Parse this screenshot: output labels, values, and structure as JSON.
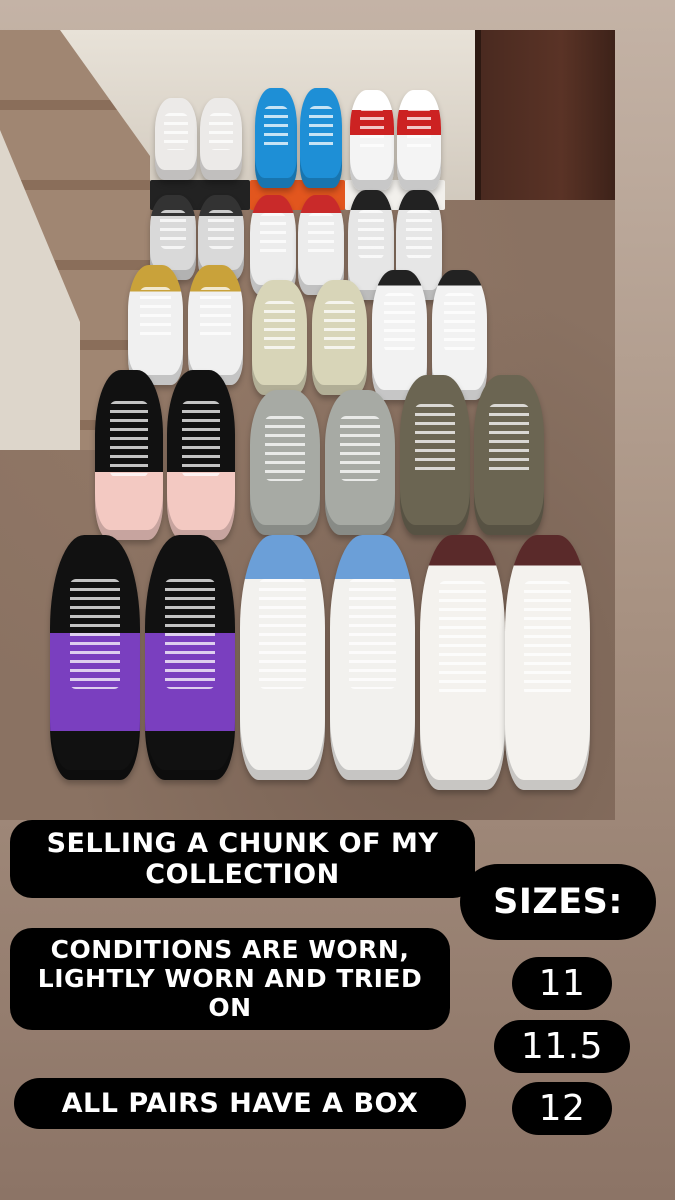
{
  "story": {
    "headline_line1": "SELLING A CHUNK OF MY",
    "headline_line2": "COLLECTION",
    "conditions": "CONDITIONS ARE WORN, LIGHTLY WORN AND TRIED ON",
    "box_note": "ALL PAIRS HAVE A BOX",
    "sizes_title": "SIZES:",
    "sizes": [
      "11",
      "11.5",
      "12"
    ]
  }
}
